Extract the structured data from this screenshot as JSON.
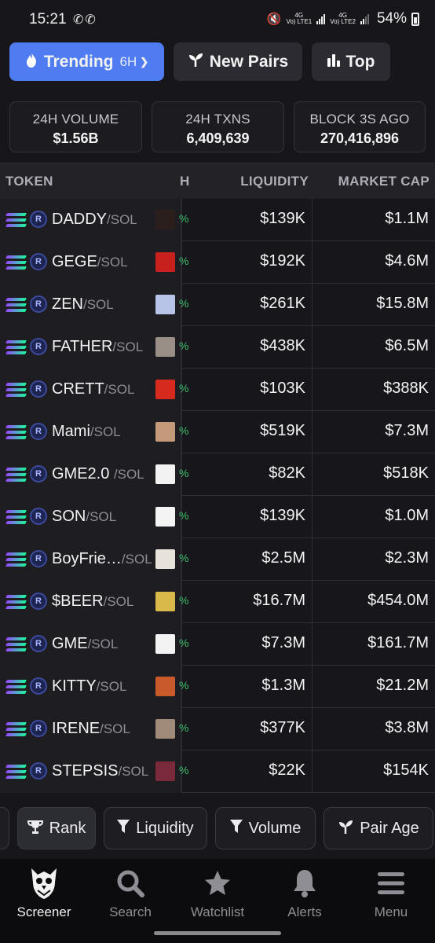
{
  "status_bar": {
    "time": "15:21",
    "sim1": "Vo) LTE1",
    "sim2": "Vo) LTE2",
    "net1": "4G",
    "net2": "4G",
    "battery": "54%"
  },
  "top_tabs": {
    "trending": "Trending",
    "trending_period": "6H",
    "new_pairs": "New Pairs",
    "top": "Top"
  },
  "stats": [
    {
      "label": "24H VOLUME",
      "value": "$1.56B"
    },
    {
      "label": "24H TXNS",
      "value": "6,409,639"
    },
    {
      "label": "BLOCK 3S AGO",
      "value": "270,416,896"
    }
  ],
  "table": {
    "headers": {
      "token": "TOKEN",
      "h": "H",
      "liquidity": "LIQUIDITY",
      "market_cap": "MARKET CAP"
    },
    "rows": [
      {
        "name": "DADDY",
        "pair": "/SOL",
        "liquidity": "$139K",
        "market_cap": "$1.1M",
        "img": "#2a1f1c"
      },
      {
        "name": "GEGE",
        "pair": "/SOL",
        "liquidity": "$192K",
        "market_cap": "$4.6M",
        "img": "#c8201c"
      },
      {
        "name": "ZEN",
        "pair": "/SOL",
        "liquidity": "$261K",
        "market_cap": "$15.8M",
        "img": "#b7c4e8"
      },
      {
        "name": "FATHER",
        "pair": "/SOL",
        "liquidity": "$438K",
        "market_cap": "$6.5M",
        "img": "#9a8f86"
      },
      {
        "name": "CRETT",
        "pair": "/SOL",
        "liquidity": "$103K",
        "market_cap": "$388K",
        "img": "#d62a1e"
      },
      {
        "name": "Mami",
        "pair": "/SOL",
        "liquidity": "$519K",
        "market_cap": "$7.3M",
        "img": "#c49a7a"
      },
      {
        "name": "GME2.0 ",
        "pair": "/SOL",
        "liquidity": "$82K",
        "market_cap": "$518K",
        "img": "#f2f2f2"
      },
      {
        "name": "SON",
        "pair": "/SOL",
        "liquidity": "$139K",
        "market_cap": "$1.0M",
        "img": "#f4f4f4"
      },
      {
        "name": "BoyFrie…",
        "pair": "/SOL",
        "liquidity": "$2.5M",
        "market_cap": "$2.3M",
        "img": "#e8e2dc"
      },
      {
        "name": "$BEER",
        "pair": "/SOL",
        "liquidity": "$16.7M",
        "market_cap": "$454.0M",
        "img": "#d9b949"
      },
      {
        "name": "GME",
        "pair": "/SOL",
        "liquidity": "$7.3M",
        "market_cap": "$161.7M",
        "img": "#f3f3f3"
      },
      {
        "name": "KITTY",
        "pair": "/SOL",
        "liquidity": "$1.3M",
        "market_cap": "$21.2M",
        "img": "#c85a2c"
      },
      {
        "name": "IRENE",
        "pair": "/SOL",
        "liquidity": "$377K",
        "market_cap": "$3.8M",
        "img": "#a08a7a"
      },
      {
        "name": "STEPSIS",
        "pair": "/SOL",
        "liquidity": "$22K",
        "market_cap": "$154K",
        "img": "#7a2a3a"
      }
    ]
  },
  "filters": {
    "rank": "Rank",
    "liquidity": "Liquidity",
    "volume": "Volume",
    "pair_age": "Pair Age"
  },
  "bottom_nav": [
    {
      "label": "Screener",
      "icon": "owl-icon"
    },
    {
      "label": "Search",
      "icon": "search-icon"
    },
    {
      "label": "Watchlist",
      "icon": "star-icon"
    },
    {
      "label": "Alerts",
      "icon": "bell-icon"
    },
    {
      "label": "Menu",
      "icon": "menu-icon"
    }
  ],
  "colors": {
    "accent": "#4f7cf0",
    "background": "#17171b",
    "positive": "#3fbf6b"
  }
}
